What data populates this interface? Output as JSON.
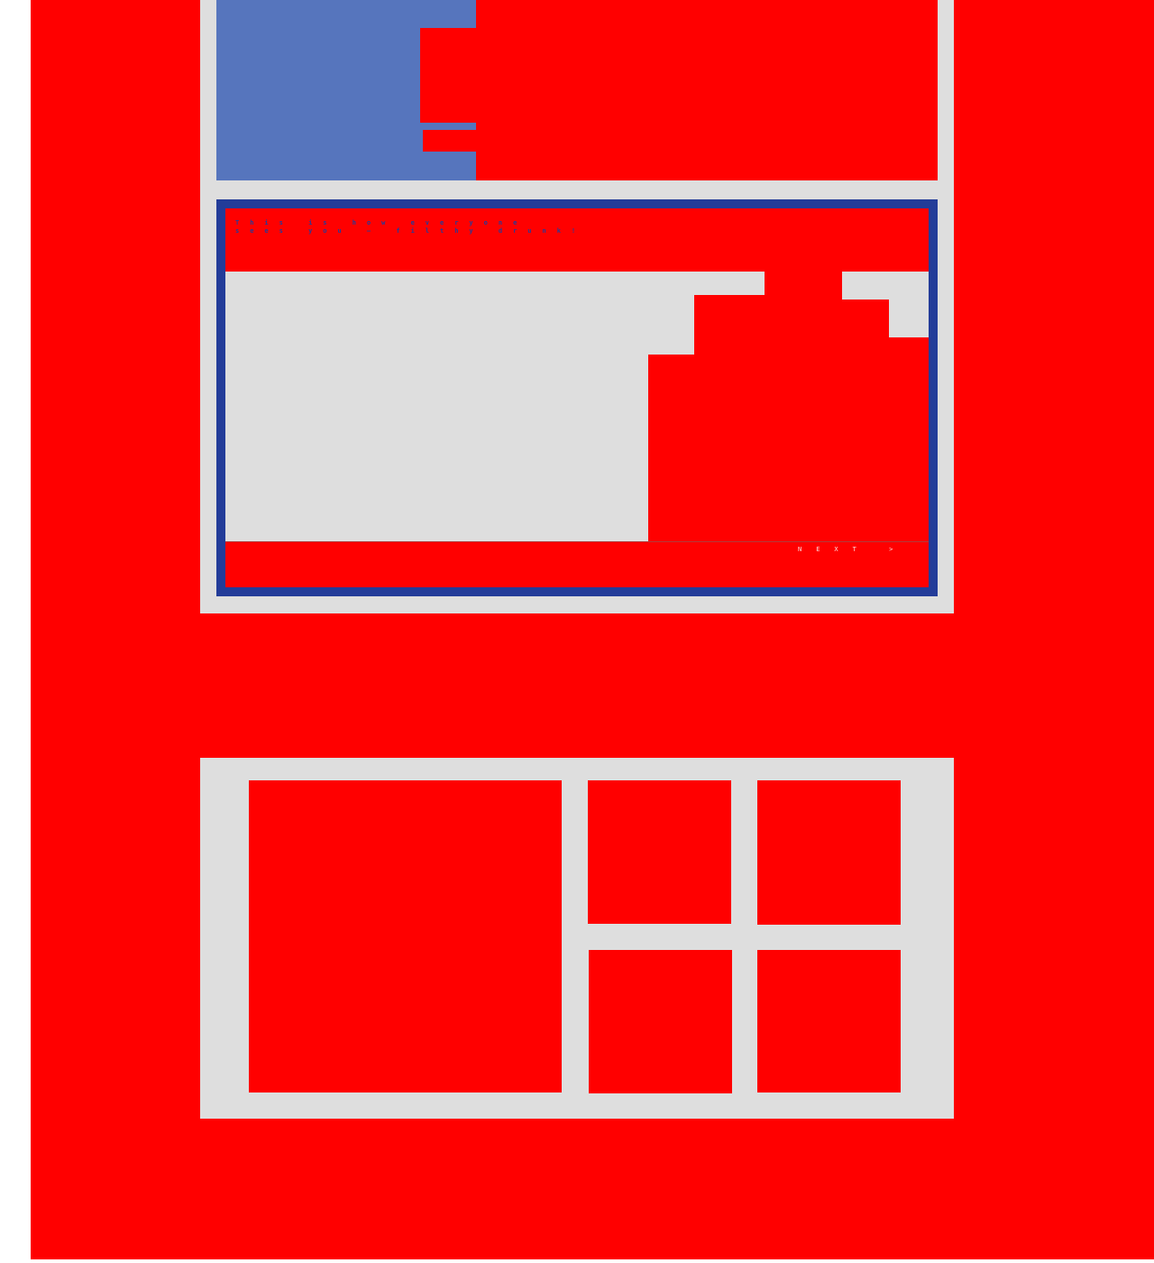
{
  "colors": {
    "page_background": "#ff0000",
    "card_background": "#dedede",
    "accent_blue": "#233c99",
    "light_blue": "#5675bd"
  },
  "slide": {
    "caption_line_1": "This is how everyone",
    "caption_line_2": "sees you — filthy drunk!",
    "next_label": "NEXT >"
  },
  "gallery": {
    "tile_count_visible": 5
  }
}
